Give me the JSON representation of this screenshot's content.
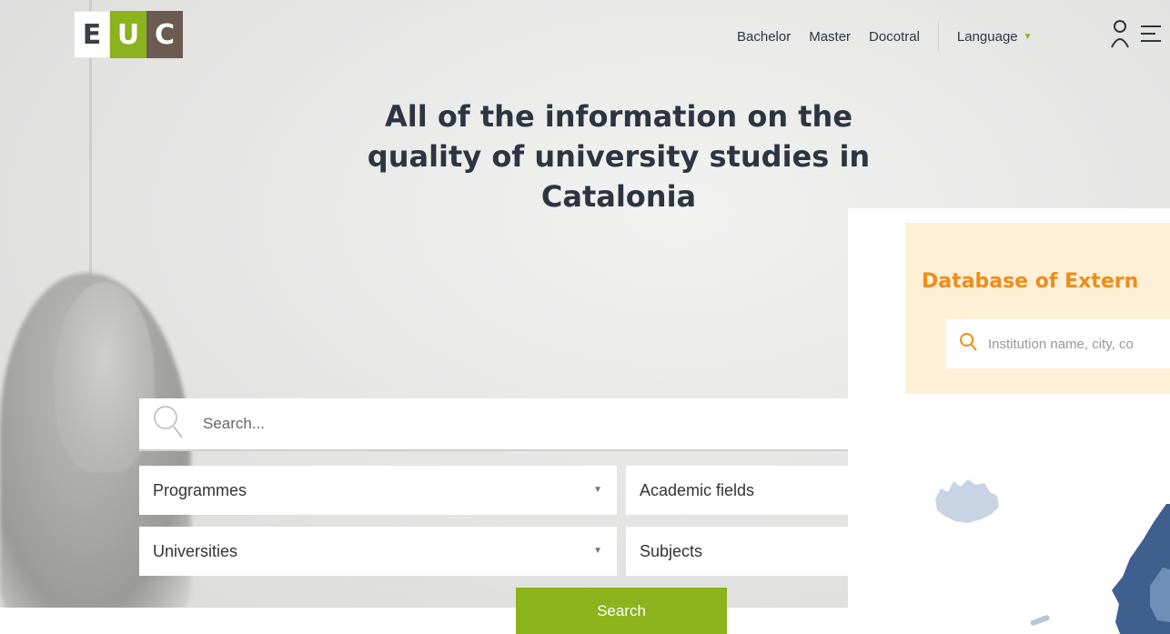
{
  "logo": {
    "letters": [
      "E",
      "U",
      "C"
    ]
  },
  "nav": {
    "bachelor": "Bachelor",
    "master": "Master",
    "doctoral": "Docotral",
    "language": "Language",
    "icons": [
      "user-icon",
      "menu-icon",
      "chevron-down-icon"
    ]
  },
  "hero": {
    "title": "All of the information on the quality of university studies in Catalonia"
  },
  "search": {
    "placeholder": "Search...",
    "icon": "search-icon"
  },
  "filters": {
    "programmes": "Programmes",
    "universities": "Universities",
    "academic_fields": "Academic fields",
    "subjects": "Subjects"
  },
  "search_button": "Search",
  "database": {
    "title": "Database of Extern",
    "placeholder": "Institution name, city, co",
    "icon": "search-icon"
  },
  "colors": {
    "accent_green": "#8ab31c",
    "logo_brown": "#6b5a4f",
    "db_orange": "#f08c1a",
    "db_card_bg": "#fdf0d7",
    "map_light": "#c8d4e3",
    "map_dark": "#3f5f8f"
  }
}
